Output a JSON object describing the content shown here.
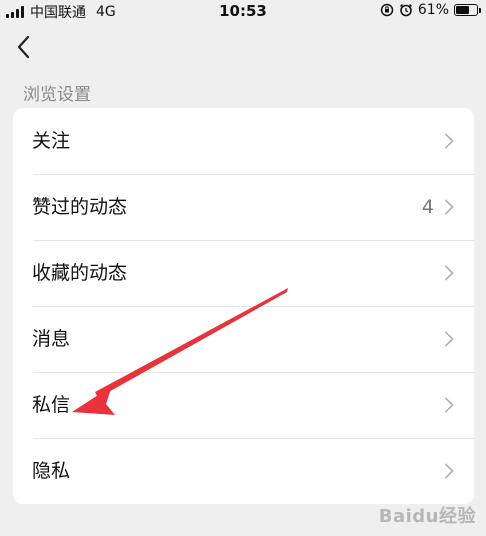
{
  "status_bar": {
    "carrier": "中国联通",
    "network": "4G",
    "time": "10:53",
    "battery_percent": "61%",
    "battery_level": 0.61,
    "icons": [
      "signal-icon",
      "lock-rotation-icon",
      "alarm-icon",
      "battery-icon"
    ]
  },
  "header": {
    "back_icon": "chevron-left-icon"
  },
  "section": {
    "title": "浏览设置"
  },
  "settings": {
    "items": [
      {
        "label": "关注",
        "count": ""
      },
      {
        "label": "赞过的动态",
        "count": "4"
      },
      {
        "label": "收藏的动态",
        "count": ""
      },
      {
        "label": "消息",
        "count": ""
      },
      {
        "label": "私信",
        "count": ""
      },
      {
        "label": "隐私",
        "count": ""
      }
    ]
  },
  "annotation": {
    "arrow_color": "#e8323c"
  },
  "watermark": {
    "text": "Baidu经验"
  }
}
